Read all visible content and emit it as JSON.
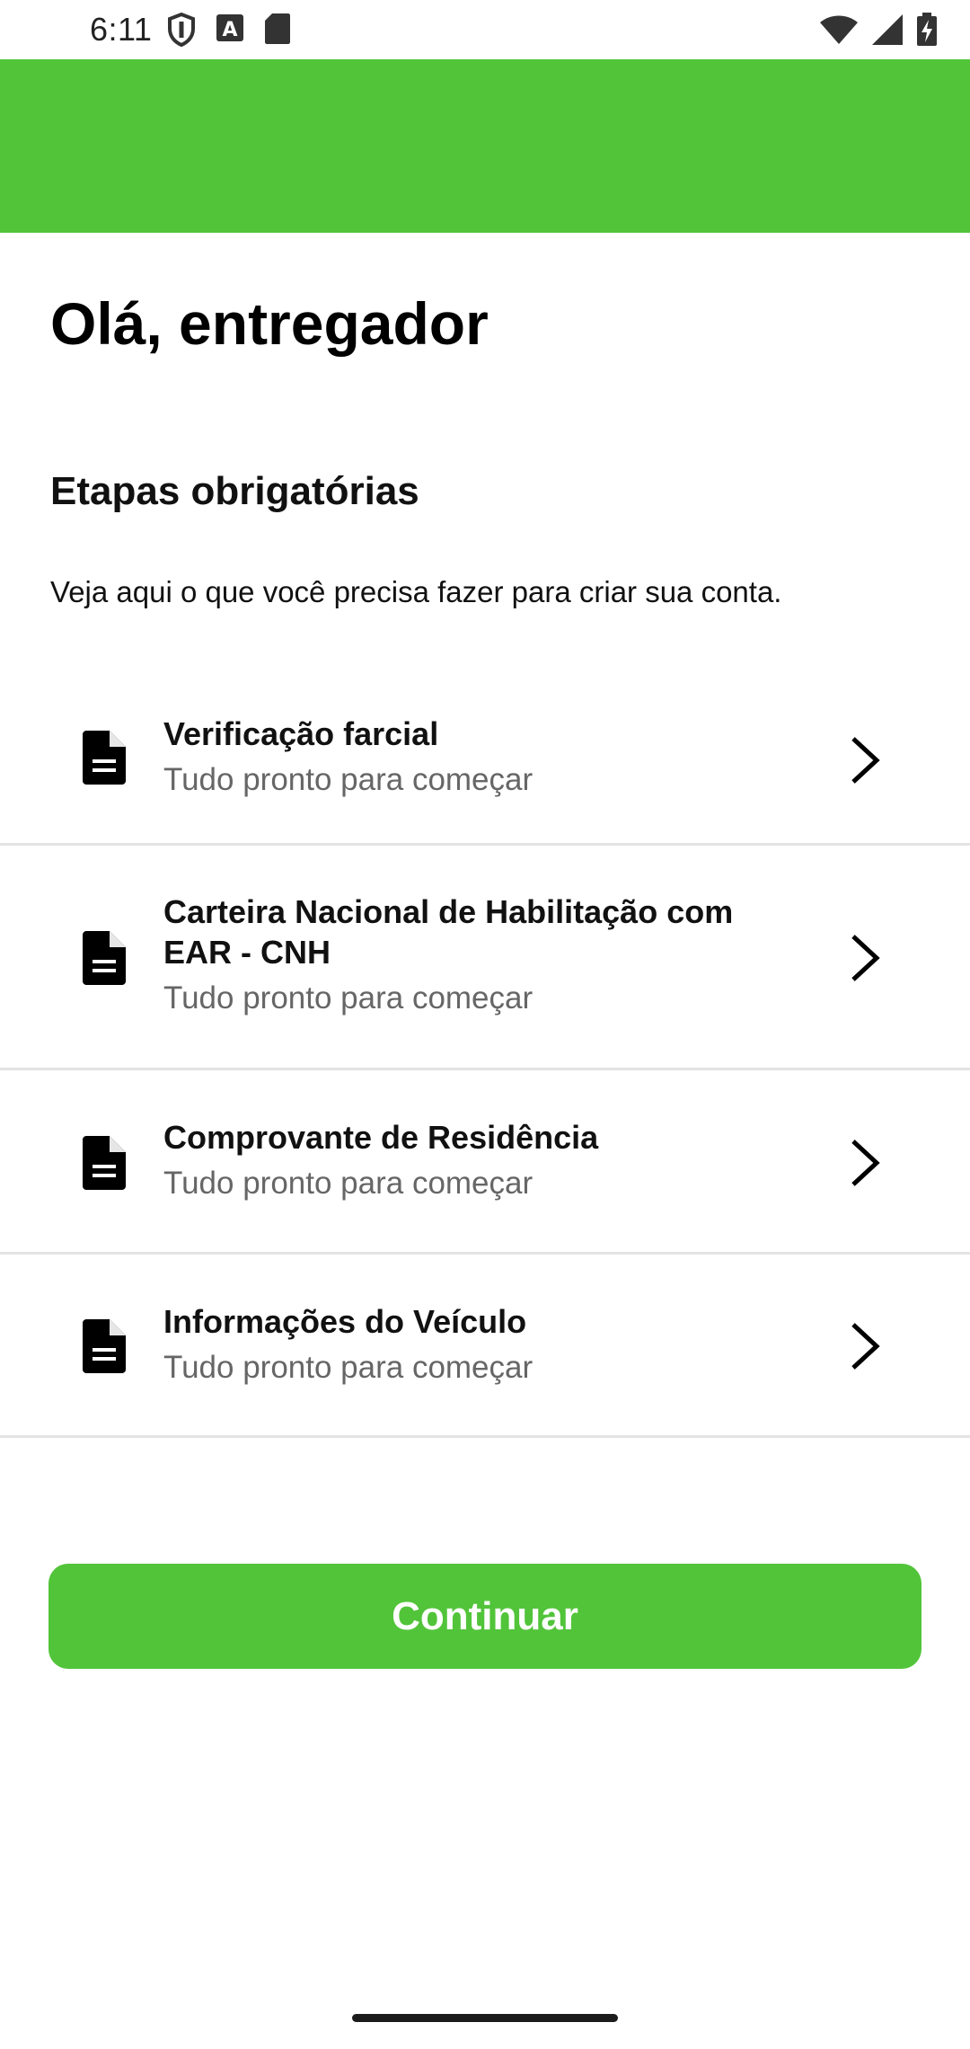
{
  "status_bar": {
    "time": "6:11",
    "icons": [
      "shield-icon",
      "a-notification-icon",
      "sd-card-icon",
      "wifi-icon",
      "cell-signal-icon",
      "battery-charging-icon"
    ]
  },
  "colors": {
    "brand_green": "#52c43a",
    "divider": "#e3e3e3",
    "subtitle_gray": "#666666"
  },
  "main": {
    "greeting": "Olá, entregador",
    "section_title": "Etapas obrigatórias",
    "section_description": "Veja aqui o que você precisa fazer para criar sua conta."
  },
  "steps": [
    {
      "title": "Verificação farcial",
      "subtitle": "Tudo pronto para começar",
      "icon": "document-icon"
    },
    {
      "title": "Carteira Nacional de Habilitação com EAR - CNH",
      "subtitle": "Tudo pronto para começar",
      "icon": "document-icon"
    },
    {
      "title": "Comprovante de Residência",
      "subtitle": "Tudo pronto para começar",
      "icon": "document-icon"
    },
    {
      "title": "Informações do Veículo",
      "subtitle": "Tudo pronto para começar",
      "icon": "document-icon"
    }
  ],
  "footer": {
    "continue_label": "Continuar"
  }
}
